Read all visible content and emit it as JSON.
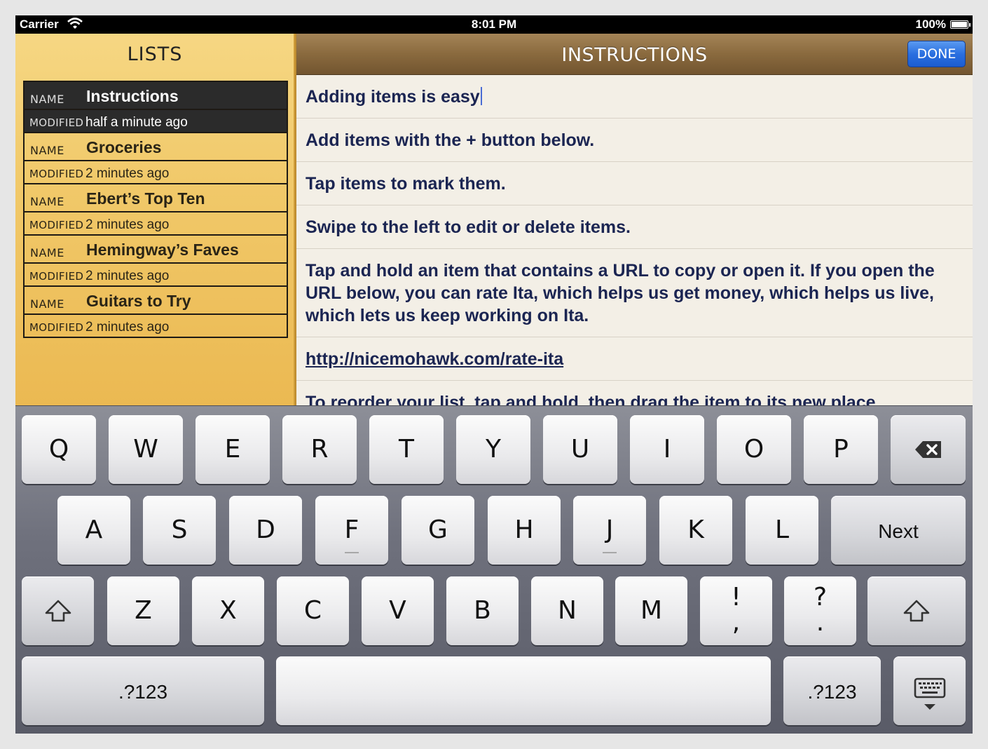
{
  "status_bar": {
    "carrier": "Carrier",
    "time": "8:01 PM",
    "battery": "100%",
    "battery_level": 1.0
  },
  "lists_panel": {
    "title": "LISTS",
    "name_label": "NAME",
    "modified_label": "MODIFIED",
    "items": [
      {
        "name": "Instructions",
        "modified": "half a minute ago",
        "selected": true
      },
      {
        "name": "Groceries",
        "modified": "2 minutes ago",
        "selected": false
      },
      {
        "name": "Ebert’s Top Ten",
        "modified": "2 minutes ago",
        "selected": false
      },
      {
        "name": "Hemingway’s Faves",
        "modified": "2 minutes ago",
        "selected": false
      },
      {
        "name": "Guitars to Try",
        "modified": "2 minutes ago",
        "selected": false
      }
    ]
  },
  "detail_panel": {
    "title": "INSTRUCTIONS",
    "done_label": "DONE",
    "items": [
      {
        "text": "Adding items is easy",
        "editing": true
      },
      {
        "text": "Add items with the + button below."
      },
      {
        "text": "Tap items to mark them."
      },
      {
        "text": "Swipe to the left to edit or delete items."
      },
      {
        "text": "Tap and hold an item that contains a URL to copy or open it. If you open the URL below, you can rate Ita, which helps us get money, which helps us live, which lets us keep working on Ita."
      },
      {
        "text": "http://nicemohawk.com/rate-ita",
        "link": true
      },
      {
        "text": "To reorder your list, tap and hold, then drag the item to its new place."
      }
    ]
  },
  "keyboard": {
    "row1": [
      "Q",
      "W",
      "E",
      "R",
      "T",
      "Y",
      "U",
      "I",
      "O",
      "P"
    ],
    "row2": [
      "A",
      "S",
      "D",
      "F",
      "G",
      "H",
      "J",
      "K",
      "L"
    ],
    "next_label": "Next",
    "row3": [
      "Z",
      "X",
      "C",
      "V",
      "B",
      "N",
      "M"
    ],
    "punct1": {
      "top": "!",
      "bottom": ","
    },
    "punct2": {
      "top": "?",
      "bottom": "."
    },
    "numbers_label": ".?123",
    "icons": {
      "backspace": "backspace-icon",
      "shift": "shift-icon",
      "dismiss": "keyboard-dismiss-icon"
    }
  },
  "colors": {
    "accent_done": "#2a6fe0",
    "item_text": "#1b2552",
    "lists_bg": "#f1c96a",
    "nav_bg": "#8a6a3e"
  }
}
